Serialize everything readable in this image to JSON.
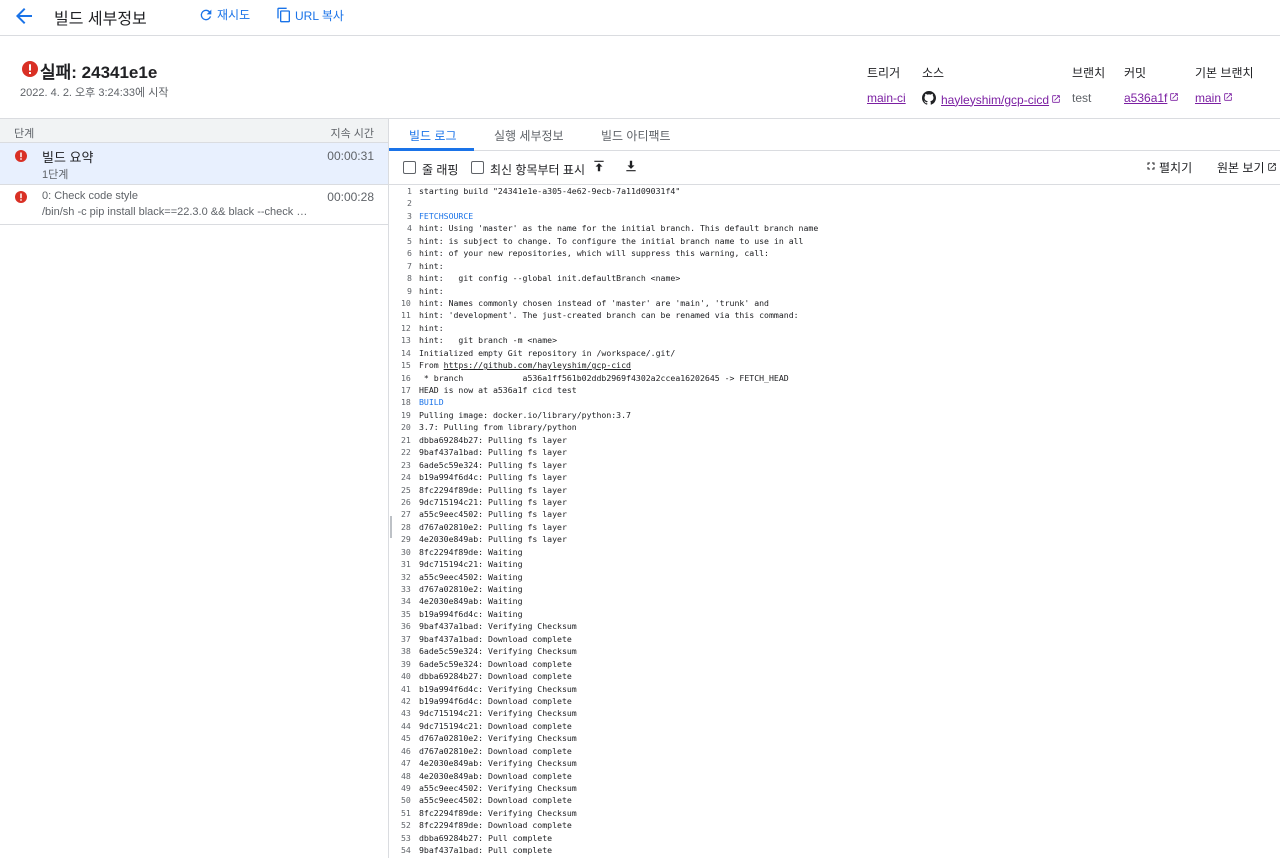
{
  "topbar": {
    "title": "빌드 세부정보",
    "retry_label": "재시도",
    "copy_url_label": "URL 복사"
  },
  "build": {
    "status_title": "실패: 24341e1e",
    "started": "2022. 4. 2. 오후 3:24:33에 시작",
    "meta": {
      "trigger_label": "트리거",
      "trigger_value": "main-ci",
      "source_label": "소스",
      "source_value": "hayleyshim/gcp-cicd",
      "branch_label": "브랜치",
      "branch_value": "test",
      "commit_label": "커밋",
      "commit_value": "a536a1f",
      "default_branch_label": "기본 브랜치",
      "default_branch_value": "main"
    }
  },
  "steps": {
    "header_steps": "단계",
    "header_duration": "지속 시간",
    "items": [
      {
        "name": "빌드 요약",
        "sub": "1단계",
        "duration": "00:00:31"
      },
      {
        "name": "0: Check code style",
        "sub": "/bin/sh -c pip install black==22.3.0 && black --check ap...",
        "duration": "00:00:28"
      }
    ]
  },
  "tabs": {
    "build_log": "빌드 로그",
    "exec_details": "실행 세부정보",
    "artifacts": "빌드 아티팩트"
  },
  "log_toolbar": {
    "wrap_label": "줄 래핑",
    "newest_first_label": "최신 항목부터 표시",
    "expand_label": "펼치기",
    "view_raw_label": "원본 보기"
  },
  "colors": {
    "accent": "#1a73e8",
    "error": "#d93025",
    "link_visited": "#7b1fa2"
  },
  "log_lines": [
    "starting build \"24341e1e-a305-4e62-9ecb-7a11d09031f4\"",
    "",
    "FETCHSOURCE",
    "hint: Using 'master' as the name for the initial branch. This default branch name",
    "hint: is subject to change. To configure the initial branch name to use in all",
    "hint: of your new repositories, which will suppress this warning, call:",
    "hint:",
    "hint:   git config --global init.defaultBranch <name>",
    "hint:",
    "hint: Names commonly chosen instead of 'master' are 'main', 'trunk' and",
    "hint: 'development'. The just-created branch can be renamed via this command:",
    "hint:",
    "hint:   git branch -m <name>",
    "Initialized empty Git repository in /workspace/.git/",
    "From https://github.com/hayleyshim/gcp-cicd",
    " * branch            a536a1ff561b02ddb2969f4302a2ccea16202645 -> FETCH_HEAD",
    "HEAD is now at a536a1f cicd test",
    "BUILD",
    "Pulling image: docker.io/library/python:3.7",
    "3.7: Pulling from library/python",
    "dbba69284b27: Pulling fs layer",
    "9baf437a1bad: Pulling fs layer",
    "6ade5c59e324: Pulling fs layer",
    "b19a994f6d4c: Pulling fs layer",
    "8fc2294f89de: Pulling fs layer",
    "9dc715194c21: Pulling fs layer",
    "a55c9eec4502: Pulling fs layer",
    "d767a02810e2: Pulling fs layer",
    "4e2030e849ab: Pulling fs layer",
    "8fc2294f89de: Waiting",
    "9dc715194c21: Waiting",
    "a55c9eec4502: Waiting",
    "d767a02810e2: Waiting",
    "4e2030e849ab: Waiting",
    "b19a994f6d4c: Waiting",
    "9baf437a1bad: Verifying Checksum",
    "9baf437a1bad: Download complete",
    "6ade5c59e324: Verifying Checksum",
    "6ade5c59e324: Download complete",
    "dbba69284b27: Download complete",
    "b19a994f6d4c: Verifying Checksum",
    "b19a994f6d4c: Download complete",
    "9dc715194c21: Verifying Checksum",
    "9dc715194c21: Download complete",
    "d767a02810e2: Verifying Checksum",
    "d767a02810e2: Download complete",
    "4e2030e849ab: Verifying Checksum",
    "4e2030e849ab: Download complete",
    "a55c9eec4502: Verifying Checksum",
    "a55c9eec4502: Download complete",
    "8fc2294f89de: Verifying Checksum",
    "8fc2294f89de: Download complete",
    "dbba69284b27: Pull complete",
    "9baf437a1bad: Pull complete"
  ]
}
